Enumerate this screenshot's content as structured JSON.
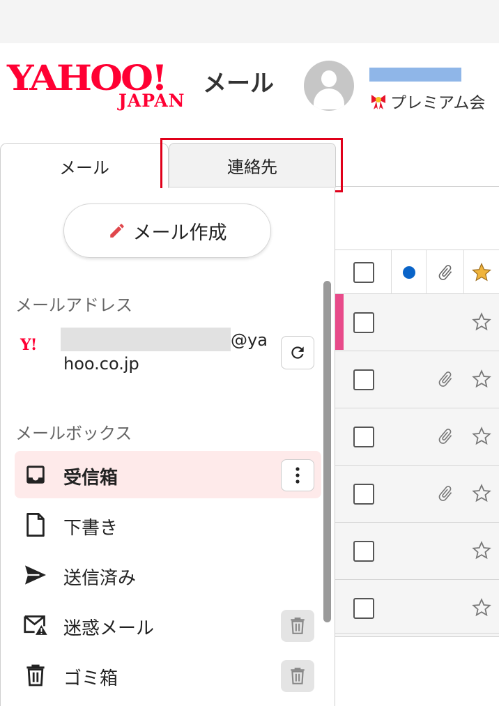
{
  "header": {
    "logo_main": "YAHOO!",
    "logo_sub": "JAPAN",
    "app_name": "メール",
    "membership": "プレミアム会"
  },
  "tabs": [
    {
      "label": "メール",
      "selected": true
    },
    {
      "label": "連絡先",
      "selected": false,
      "highlighted": true
    }
  ],
  "sidebar": {
    "compose_label": "メール作成",
    "address_section_title": "メールアドレス",
    "address_logo": "Y!",
    "address_suffix_1": "@ya",
    "address_suffix_2": "hoo.co.jp",
    "mailbox_section_title": "メールボックス",
    "folders": [
      {
        "label": "受信箱",
        "icon": "inbox-icon",
        "active": true,
        "action": "more-menu"
      },
      {
        "label": "下書き",
        "icon": "draft-icon",
        "active": false
      },
      {
        "label": "送信済み",
        "icon": "send-icon",
        "active": false
      },
      {
        "label": "迷惑メール",
        "icon": "spam-icon",
        "active": false,
        "action": "empty-trash"
      },
      {
        "label": "ゴミ箱",
        "icon": "trash-icon",
        "active": false,
        "action": "empty-trash"
      }
    ]
  },
  "message_list": {
    "header_icons": [
      "checkbox",
      "unread-dot-icon",
      "attachment-icon",
      "star-icon"
    ],
    "rows": [
      {
        "unread_mark": true,
        "attachment": false,
        "starred": false
      },
      {
        "unread_mark": false,
        "attachment": true,
        "starred": false
      },
      {
        "unread_mark": false,
        "attachment": true,
        "starred": false
      },
      {
        "unread_mark": false,
        "attachment": true,
        "starred": false
      },
      {
        "unread_mark": false,
        "attachment": false,
        "starred": false
      },
      {
        "unread_mark": false,
        "attachment": false,
        "starred": false
      }
    ]
  },
  "colors": {
    "brand_red": "#ff0033",
    "highlight_red": "#e0001a",
    "active_folder_bg": "#feeaea",
    "unread_blue": "#0a64c8",
    "unread_mark_pink": "#e84b8a",
    "star_gold": "#f0b43c"
  }
}
